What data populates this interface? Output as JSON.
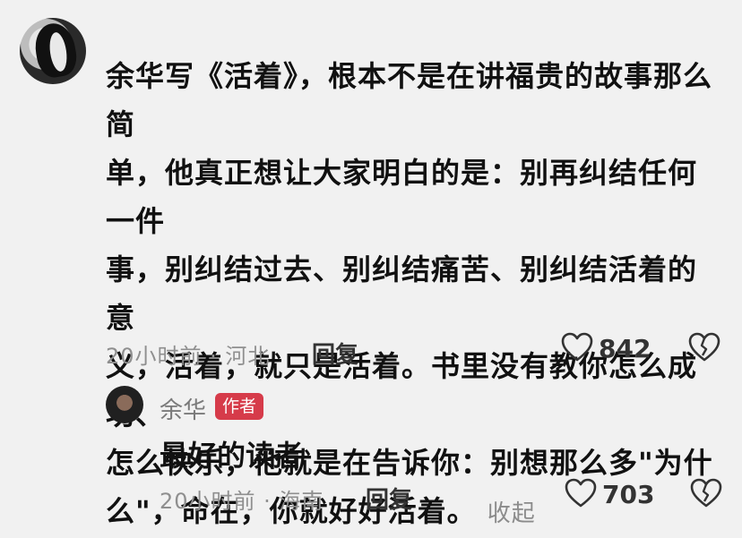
{
  "comment": {
    "lines": [
      "余华写《活着》，根本不是在讲福贵的故事那么简",
      "单，他真正想让大家明白的是：别再纠结任何一件",
      "事，别纠结过去、别纠结痛苦、别纠结活着的意",
      "义，活着，就只是活着。书里没有教你怎么成功、",
      "怎么快乐，他就是在告诉你：别想那么多\"为什",
      "么\"，命在，你就好好活着。"
    ],
    "collapse_label": "收起",
    "time_location": "20小时前 · 河北",
    "reply_label": "回复",
    "like_count": "842"
  },
  "author_reply": {
    "name": "余华",
    "badge": "作者",
    "text": "最好的读者",
    "time_location": "20小时前 · 海南",
    "reply_label": "回复",
    "like_count": "703"
  },
  "colors": {
    "badge": "#d63b4a",
    "background": "#f1f1f1",
    "meta_gray": "#8f8f8f"
  },
  "icons": [
    "heart-outline-icon",
    "broken-heart-icon"
  ]
}
